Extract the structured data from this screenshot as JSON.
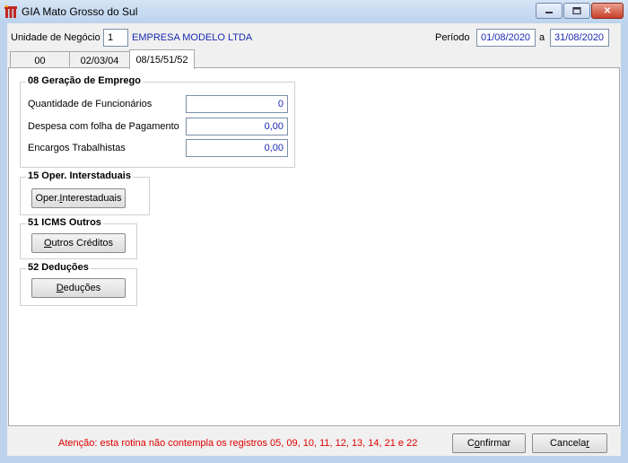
{
  "window": {
    "title": "GIA Mato Grosso do Sul",
    "controls": [
      "minimize",
      "maximize",
      "close"
    ]
  },
  "header": {
    "unit_label": "Unidade de Negócio",
    "unit_code": "1",
    "company_name": "EMPRESA MODELO LTDA",
    "period_label": "Período",
    "period_start": "01/08/2020",
    "period_sep": "a",
    "period_end": "31/08/2020"
  },
  "tabs": [
    {
      "label": "00",
      "active": false
    },
    {
      "label": "02/03/04",
      "active": false
    },
    {
      "label": "08/15/51/52",
      "active": true
    }
  ],
  "group08": {
    "title": "08 Geração de Emprego",
    "rows": [
      {
        "label": "Quantidade de Funcionários",
        "value": "0"
      },
      {
        "label": "Despesa com folha de Pagamento",
        "value": "0,00"
      },
      {
        "label": "Encargos Trabalhistas",
        "value": "0,00"
      }
    ]
  },
  "group15": {
    "title": "15 Oper. Interstaduais",
    "button_pre": "Oper. ",
    "button_u": "I",
    "button_post": "nterestaduais"
  },
  "group51": {
    "title": "51 ICMS Outros",
    "button_pre": "",
    "button_u": "O",
    "button_post": "utros Créditos"
  },
  "group52": {
    "title": "52 Deduções",
    "button_pre": "",
    "button_u": "D",
    "button_post": "eduções"
  },
  "footer": {
    "warning": "Atenção: esta rotina não contempla os registros 05, 09, 10, 11, 12, 13, 14, 21 e 22",
    "confirm_pre": "C",
    "confirm_u": "o",
    "confirm_post": "nfirmar",
    "cancel_pre": "Cancela",
    "cancel_u": "r",
    "cancel_post": ""
  },
  "colors": {
    "value_text": "#1a2bb0",
    "warning_text": "#e00000",
    "title_bar": "#bcd3ee"
  }
}
